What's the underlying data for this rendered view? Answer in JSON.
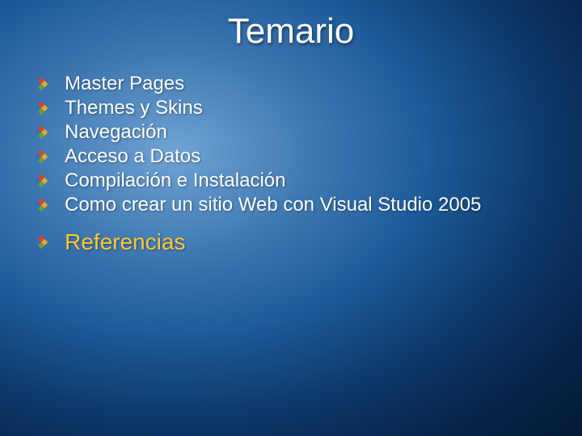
{
  "title": "Temario",
  "items": [
    {
      "label": "Master Pages",
      "highlight": false
    },
    {
      "label": "Themes y Skins",
      "highlight": false
    },
    {
      "label": "Navegación",
      "highlight": false
    },
    {
      "label": "Acceso a Datos",
      "highlight": false
    },
    {
      "label": "Compilación e Instalación",
      "highlight": false
    },
    {
      "label": "Como crear un sitio Web con Visual Studio 2005",
      "highlight": false
    },
    {
      "label": "Referencias",
      "highlight": true
    }
  ],
  "colors": {
    "bullet_red": "#d8432b",
    "bullet_yellow": "#e7a92e",
    "bullet_green": "#6aa038",
    "bullet_blue": "#3b6fae"
  }
}
